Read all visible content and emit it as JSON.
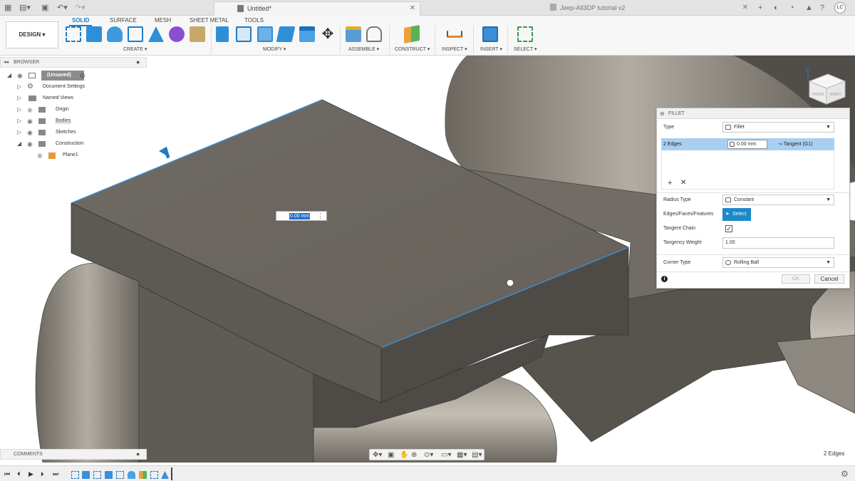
{
  "title_bar": {
    "doc_tab_active": "Untitled*",
    "doc_tab_other": "Jeep-All3DP tutorial v2",
    "user_initials": "LC"
  },
  "toolbar": {
    "workspace_tabs": [
      "SOLID",
      "SURFACE",
      "MESH",
      "SHEET METAL",
      "TOOLS"
    ],
    "design_button": "DESIGN ▾",
    "groups": [
      "CREATE ▾",
      "MODIFY ▾",
      "ASSEMBLE ▾",
      "CONSTRUCT ▾",
      "INSPECT ▾",
      "INSERT ▾",
      "SELECT ▾"
    ]
  },
  "browser": {
    "header": "BROWSER",
    "items": [
      {
        "label": "(Unsaved)"
      },
      {
        "label": "Document Settings"
      },
      {
        "label": "Named Views"
      },
      {
        "label": "Origin"
      },
      {
        "label": "Bodies"
      },
      {
        "label": "Sketches"
      },
      {
        "label": "Construction"
      },
      {
        "label": "Plane1"
      }
    ]
  },
  "viewport": {
    "radius_input": "0.00 mm",
    "selection_count": "2 Edges"
  },
  "view_cube": {
    "front": "FRONT",
    "right": "RIGHT",
    "axis_z": "Z"
  },
  "fillet": {
    "title": "FILLET",
    "type_label": "Type",
    "type_value": "Fillet",
    "edges_label": "2 Edges",
    "radius_value": "0.00 mm",
    "continuity": "Tangent (G1)",
    "radius_type_label": "Radius Type",
    "radius_type_value": "Constant",
    "edges_faces_label": "Edges/Faces/Features",
    "select_button": "Select",
    "tangent_chain_label": "Tangent Chain",
    "tangent_chain_checked": true,
    "tangency_weight_label": "Tangency Weight",
    "tangency_weight_value": "1.00",
    "corner_type_label": "Corner Type",
    "corner_type_value": "Rolling Ball",
    "ok_label": "OK",
    "cancel_label": "Cancel"
  },
  "comments": {
    "label": "COMMENTS"
  },
  "colors": {
    "accent": "#1c7ec5",
    "select_blue": "#1c89c9",
    "model_top": "#6c6861",
    "model_front": "#5d5a54",
    "model_side": "#4f4c47",
    "highlight_edge": "#3b8fd8"
  }
}
